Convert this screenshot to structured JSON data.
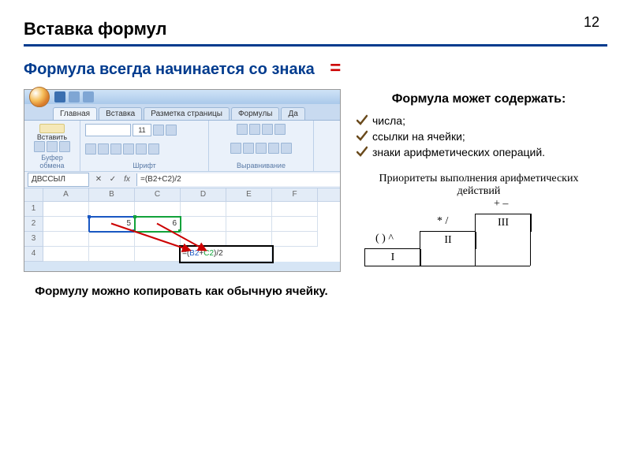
{
  "page_number": "12",
  "title": "Вставка формул",
  "subtitle": "Формула всегда начинается со знака",
  "equals_sign": "=",
  "excel": {
    "tabs": [
      "Главная",
      "Вставка",
      "Разметка страницы",
      "Формулы",
      "Да"
    ],
    "active_tab": "Главная",
    "groups": {
      "clipboard": {
        "paste": "Вставить",
        "label": "Буфер обмена"
      },
      "font": {
        "name": "",
        "size": "11",
        "label": "Шрифт"
      },
      "align": {
        "label": "Выравнивание"
      }
    },
    "name_box": "ДВССЫЛ",
    "fmla_btns": {
      "cancel": "✕",
      "enter": "✓",
      "fx": "fx"
    },
    "formula_bar": "=(B2+C2)/2",
    "columns": [
      "A",
      "B",
      "C",
      "D",
      "E",
      "F"
    ],
    "row_count": 4,
    "cells": {
      "B2": "5",
      "C2": "6",
      "D4_prefix": "=(",
      "D4_b": "B2",
      "D4_plus": "+",
      "D4_g": "C2",
      "D4_suffix": ")/2"
    }
  },
  "right": {
    "contain_head": "Формула может содержать:",
    "items": [
      "числа;",
      "ссылки на ячейки;",
      "знаки арифметических операций."
    ],
    "priority_title": "Приоритеты выполнения арифметических действий",
    "steps": {
      "s1": "I",
      "s2": "II",
      "s3": "III"
    },
    "labels": {
      "l1": "( ) ^",
      "l2": "* /",
      "l3": "+ –"
    }
  },
  "copy_note": "Формулу можно копировать как обычную ячейку."
}
